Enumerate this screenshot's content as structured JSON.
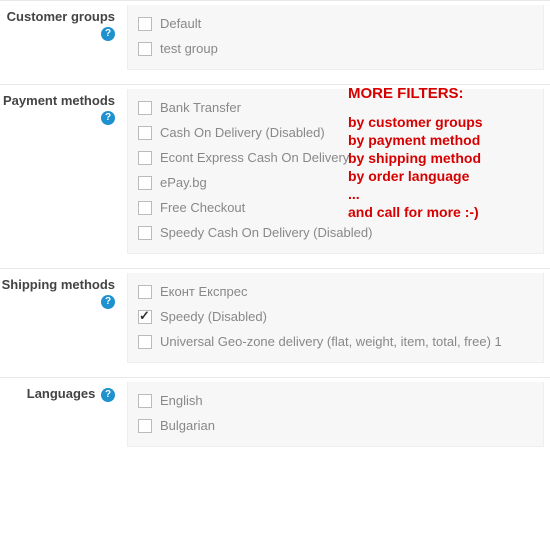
{
  "sections": {
    "customer_groups": {
      "label": "Customer groups",
      "items": [
        {
          "label": "Default",
          "checked": false
        },
        {
          "label": "test group",
          "checked": false
        }
      ]
    },
    "payment_methods": {
      "label": "Payment methods",
      "items": [
        {
          "label": "Bank Transfer",
          "checked": false
        },
        {
          "label": "Cash On Delivery (Disabled)",
          "checked": false
        },
        {
          "label": "Econt Express Cash On Delivery",
          "checked": false
        },
        {
          "label": "ePay.bg",
          "checked": false
        },
        {
          "label": "Free Checkout",
          "checked": false
        },
        {
          "label": "Speedy Cash On Delivery (Disabled)",
          "checked": false
        }
      ]
    },
    "shipping_methods": {
      "label": "Shipping methods",
      "items": [
        {
          "label": "Еконт Експрес",
          "checked": false
        },
        {
          "label": "Speedy (Disabled)",
          "checked": true
        },
        {
          "label": "Universal Geo-zone delivery (flat, weight, item, total, free) 1",
          "checked": false
        }
      ]
    },
    "languages": {
      "label": "Languages",
      "items": [
        {
          "label": "English",
          "checked": false
        },
        {
          "label": "Bulgarian",
          "checked": false
        }
      ]
    }
  },
  "annotation": {
    "title": "MORE FILTERS:",
    "lines": [
      "by customer groups",
      "by payment method",
      "by shipping method",
      "by order language",
      "...",
      "and call for more :-)"
    ]
  },
  "help_glyph": "?"
}
